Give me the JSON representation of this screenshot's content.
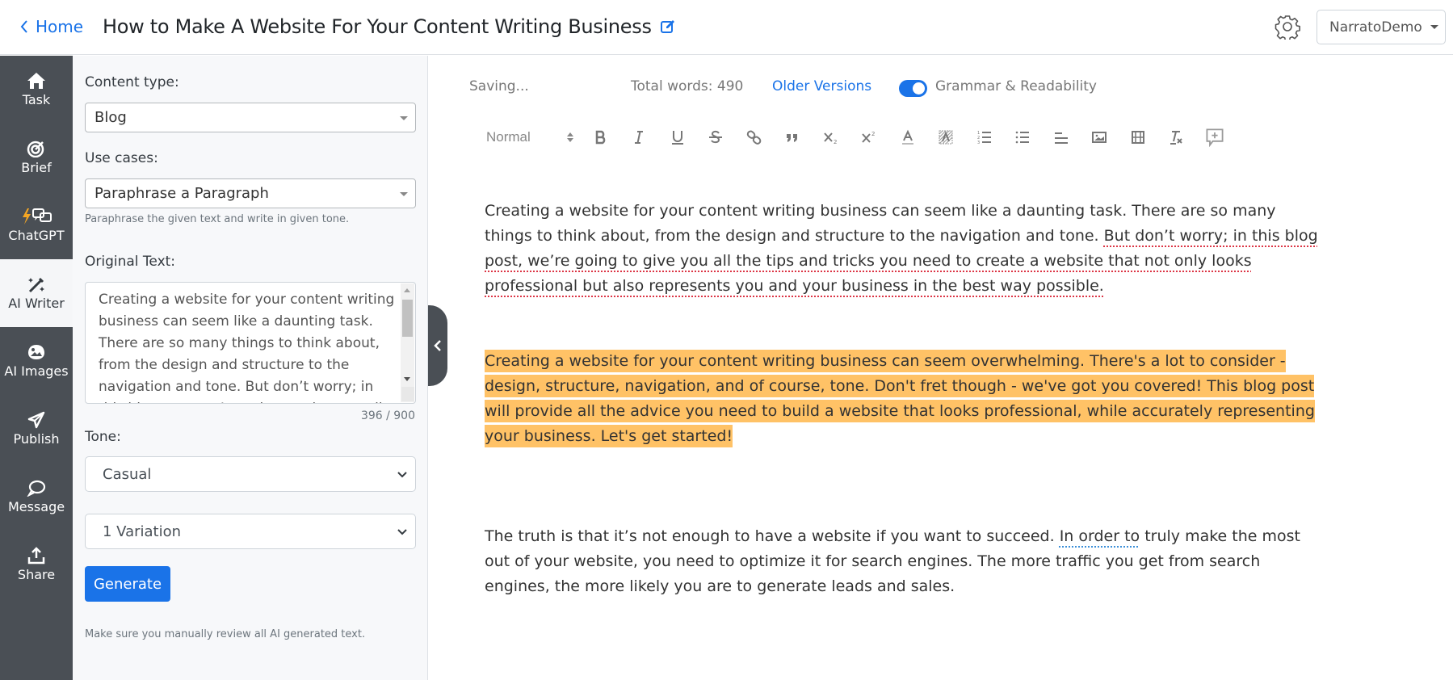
{
  "header": {
    "back_label": "Home",
    "title": "How to Make A Website For Your Content Writing Business",
    "user_menu": "NarratoDemo"
  },
  "leftnav": {
    "items": [
      {
        "label": "Task",
        "icon": "home-icon"
      },
      {
        "label": "Brief",
        "icon": "target-icon"
      },
      {
        "label": "ChatGPT",
        "icon": "chat-bolt-icon"
      },
      {
        "label": "AI Writer",
        "icon": "magic-wand-icon",
        "active": true
      },
      {
        "label": "AI Images",
        "icon": "image-icon"
      },
      {
        "label": "Publish",
        "icon": "paper-plane-icon"
      },
      {
        "label": "Message",
        "icon": "speech-bubble-icon"
      },
      {
        "label": "Share",
        "icon": "upload-icon"
      }
    ]
  },
  "panel": {
    "content_type_label": "Content type:",
    "content_type_value": "Blog",
    "use_cases_label": "Use cases:",
    "use_case_value": "Paraphrase a Paragraph",
    "use_case_hint": "Paraphrase the given text and write in given tone.",
    "original_text_label": "Original Text:",
    "original_text_value": "Creating a website for your content writing business can seem like a daunting task. There are so many things to think about, from the design and structure to the navigation and tone. But don’t worry; in this blog post, we’re going to give you all the tips and tricks you need to create a website that not only looks professional but also represents you and your business in the best way possible.",
    "char_count": "396 / 900",
    "tone_label": "Tone:",
    "tone_value": "Casual",
    "variation_value": "1 Variation",
    "generate_label": "Generate",
    "disclaimer": "Make sure you manually review all AI generated text."
  },
  "editor": {
    "save_status": "Saving...",
    "word_count": "Total words: 490",
    "older_versions": "Older Versions",
    "grammar_toggle_label": "Grammar & Readability",
    "grammar_toggle_on": true,
    "heading_select": "Normal",
    "toolbar": [
      "bold",
      "italic",
      "underline",
      "strike",
      "link",
      "blockquote",
      "subscript",
      "superscript",
      "text-color",
      "background-color",
      "ordered-list",
      "bullet-list",
      "align",
      "image",
      "video",
      "clear-format",
      "add-comment"
    ],
    "p1_a": "Creating a website for your content writing business can seem like a daunting task. There are so many things to think about, from the design and structure to the navigation and tone. ",
    "p1_b": "But don’t worry; in this blog post, we’re going to give you all the tips and tricks you need to create a website that not only looks professional but also represents you and your business in the best way possible.",
    "p2": "Creating a website for your content writing business can seem overwhelming. There's a lot to consider - design, structure, navigation, and of course, tone. Don't fret though - we've got you covered! This blog post will provide all the advice you need to build a website that looks professional, while accurately representing your business. Let's get started!",
    "p3_a": "The truth is that it’s not enough to have a website if you want to succeed. ",
    "p3_b": "In order to",
    "p3_c": " truly make the most out of your website, you need to optimize it for search engines. The more traffic you get from search engines, the more likely you are to generate leads and sales."
  },
  "colors": {
    "accent": "#1a73e8",
    "sidebar": "#4a4f55",
    "highlight": "#ffc266",
    "grammar_error": "#dc3545",
    "style_suggestion": "#3b8fd9"
  }
}
